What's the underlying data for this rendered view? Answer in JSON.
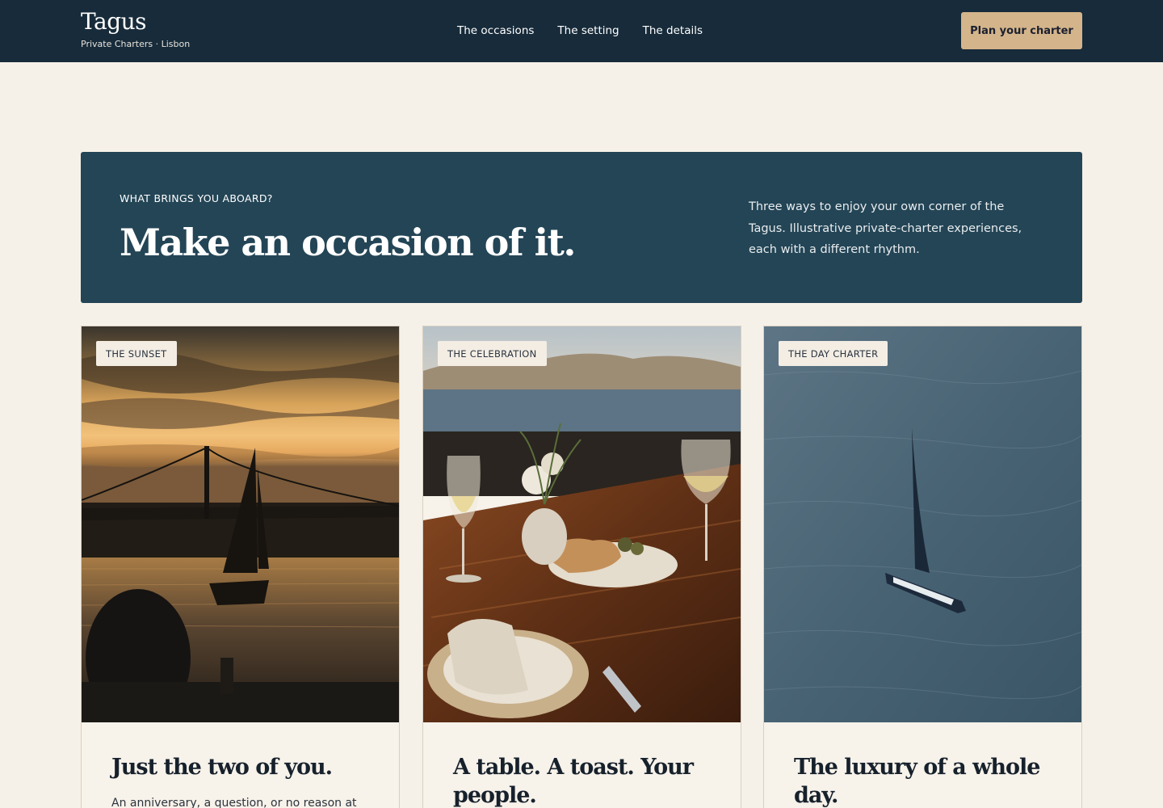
{
  "header": {
    "brand_name": "Tagus",
    "brand_subtitle": "Private Charters · Lisbon",
    "nav": [
      {
        "label": "The occasions"
      },
      {
        "label": "The setting"
      },
      {
        "label": "The details"
      }
    ],
    "cta_label": "Plan your charter"
  },
  "banner": {
    "eyebrow": "WHAT BRINGS YOU ABOARD?",
    "headline": "Make an occasion of it.",
    "description": "Three ways to enjoy your own corner of the Tagus. Illustrative private-charter experiences, each with a different rhythm."
  },
  "cards": [
    {
      "badge": "THE SUNSET",
      "title": "Just the two of you.",
      "description": "An anniversary, a question, or no reason at",
      "image": "sunset-bridge-sailboat"
    },
    {
      "badge": "THE CELEBRATION",
      "title": "A table. A toast. Your people.",
      "description": "",
      "image": "table-wine-glasses"
    },
    {
      "badge": "THE DAY CHARTER",
      "title": "The luxury of a whole day.",
      "description": "",
      "image": "sailboat-open-water"
    }
  ],
  "colors": {
    "header_bg": "#172b3a",
    "banner_bg": "#234556",
    "page_bg": "#f6f1e8",
    "accent": "#d4b48a"
  }
}
